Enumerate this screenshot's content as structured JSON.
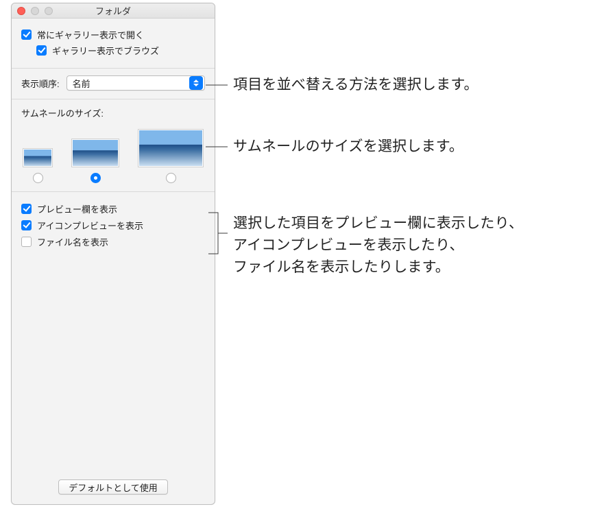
{
  "window": {
    "title": "フォルダ"
  },
  "general": {
    "always_open_gallery": {
      "label": "常にギャラリー表示で開く",
      "checked": true
    },
    "browse_in_gallery": {
      "label": "ギャラリー表示でブラウズ",
      "checked": true
    }
  },
  "sort": {
    "label": "表示順序:",
    "value": "名前"
  },
  "thumb": {
    "label": "サムネールのサイズ:",
    "selected": "md"
  },
  "options": {
    "show_preview_column": {
      "label": "プレビュー欄を表示",
      "checked": true
    },
    "show_icon_preview": {
      "label": "アイコンプレビューを表示",
      "checked": true
    },
    "show_filename": {
      "label": "ファイル名を表示",
      "checked": false
    }
  },
  "footer": {
    "use_as_defaults": "デフォルトとして使用"
  },
  "callouts": {
    "c1": "項目を並べ替える方法を選択します。",
    "c2": "サムネールのサイズを選択します。",
    "c3": "選択した項目をプレビュー欄に表示したり、\nアイコンプレビューを表示したり、\nファイル名を表示したりします。"
  }
}
